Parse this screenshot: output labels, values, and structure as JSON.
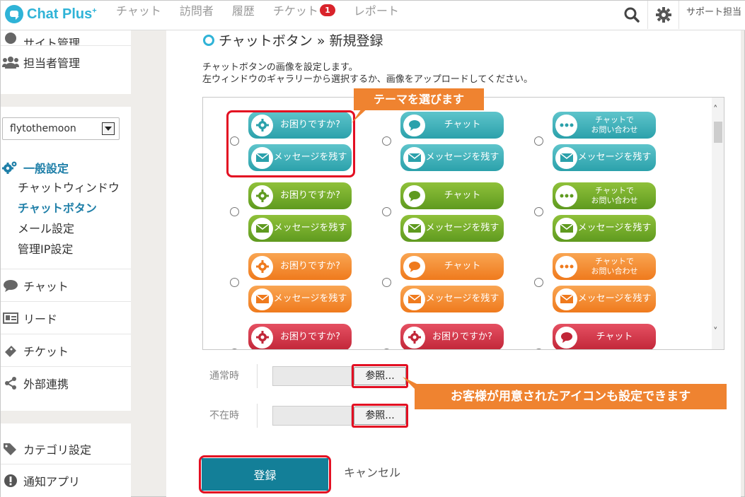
{
  "app": {
    "name": "Chat Plus",
    "sup": "+"
  },
  "nav": {
    "items": [
      {
        "label": "チャット"
      },
      {
        "label": "訪問者"
      },
      {
        "label": "履歴"
      },
      {
        "label": "チケット",
        "badge": "1"
      },
      {
        "label": "レポート"
      }
    ],
    "support_label": "サポート担当"
  },
  "sidebar": {
    "top_items": [
      {
        "label": "サイト管理"
      },
      {
        "label": "担当者管理"
      }
    ],
    "site_select": "flytothemoon",
    "section_title": "一般設定",
    "sub_items": [
      {
        "label": "チャットウィンドウ"
      },
      {
        "label": "チャットボタン"
      },
      {
        "label": "メール設定"
      },
      {
        "label": "管理IP設定"
      }
    ],
    "bottom_items": [
      {
        "label": "チャット"
      },
      {
        "label": "リード"
      },
      {
        "label": "チケット"
      },
      {
        "label": "外部連携"
      }
    ],
    "footer_items": [
      {
        "label": "カテゴリ設定"
      },
      {
        "label": "通知アプリ"
      }
    ]
  },
  "main": {
    "title": "チャットボタン » 新規登録",
    "desc_line1": "チャットボタンの画像を設定します。",
    "desc_line2": "左ウィンドウのギャラリーから選択するか、画像をアップロードしてください。",
    "button_labels": {
      "help": "お困りですか?",
      "chat": "チャット",
      "contact_line1": "チャットで",
      "contact_line2": "お問い合わせ",
      "message": "メッセージを残す"
    },
    "theme_colors": {
      "teal": "#2ba1ab",
      "green": "#5f9a1f",
      "orange": "#ef7a1d",
      "red": "#c12638"
    },
    "callout_theme": "テーマを選びます",
    "callout_icon": "お客様が用意されたアイコンも設定できます",
    "normal_label": "通常時",
    "away_label": "不在時",
    "browse_label": "参照...",
    "submit_label": "登録",
    "cancel_label": "キャンセル"
  }
}
